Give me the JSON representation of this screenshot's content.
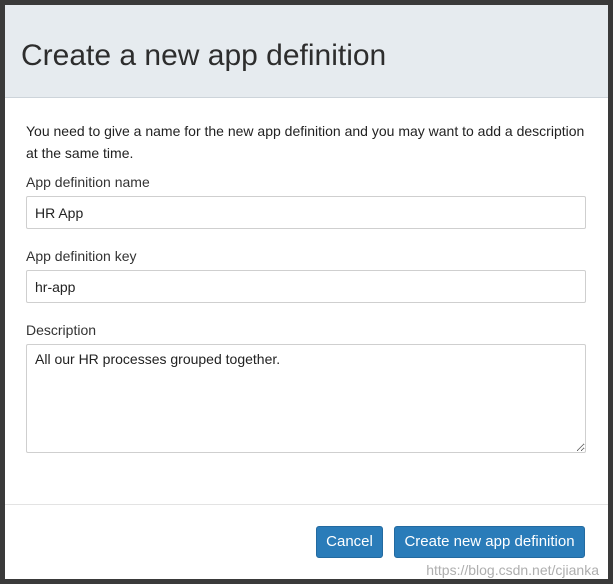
{
  "dialog": {
    "title": "Create a new app definition",
    "intro": "You need to give a name for the new app definition and you may want to add a description at the same time.",
    "fields": {
      "name": {
        "label": "App definition name",
        "value": "HR App"
      },
      "key": {
        "label": "App definition key",
        "value": "hr-app"
      },
      "description": {
        "label": "Description",
        "value": "All our HR processes grouped together."
      }
    },
    "buttons": {
      "cancel": "Cancel",
      "create": "Create new app definition"
    }
  },
  "watermark": "https://blog.csdn.net/cjianka",
  "colors": {
    "header_bg": "#e6ebef",
    "primary_button": "#2a7cb9",
    "backdrop": "#3a3a3a"
  }
}
